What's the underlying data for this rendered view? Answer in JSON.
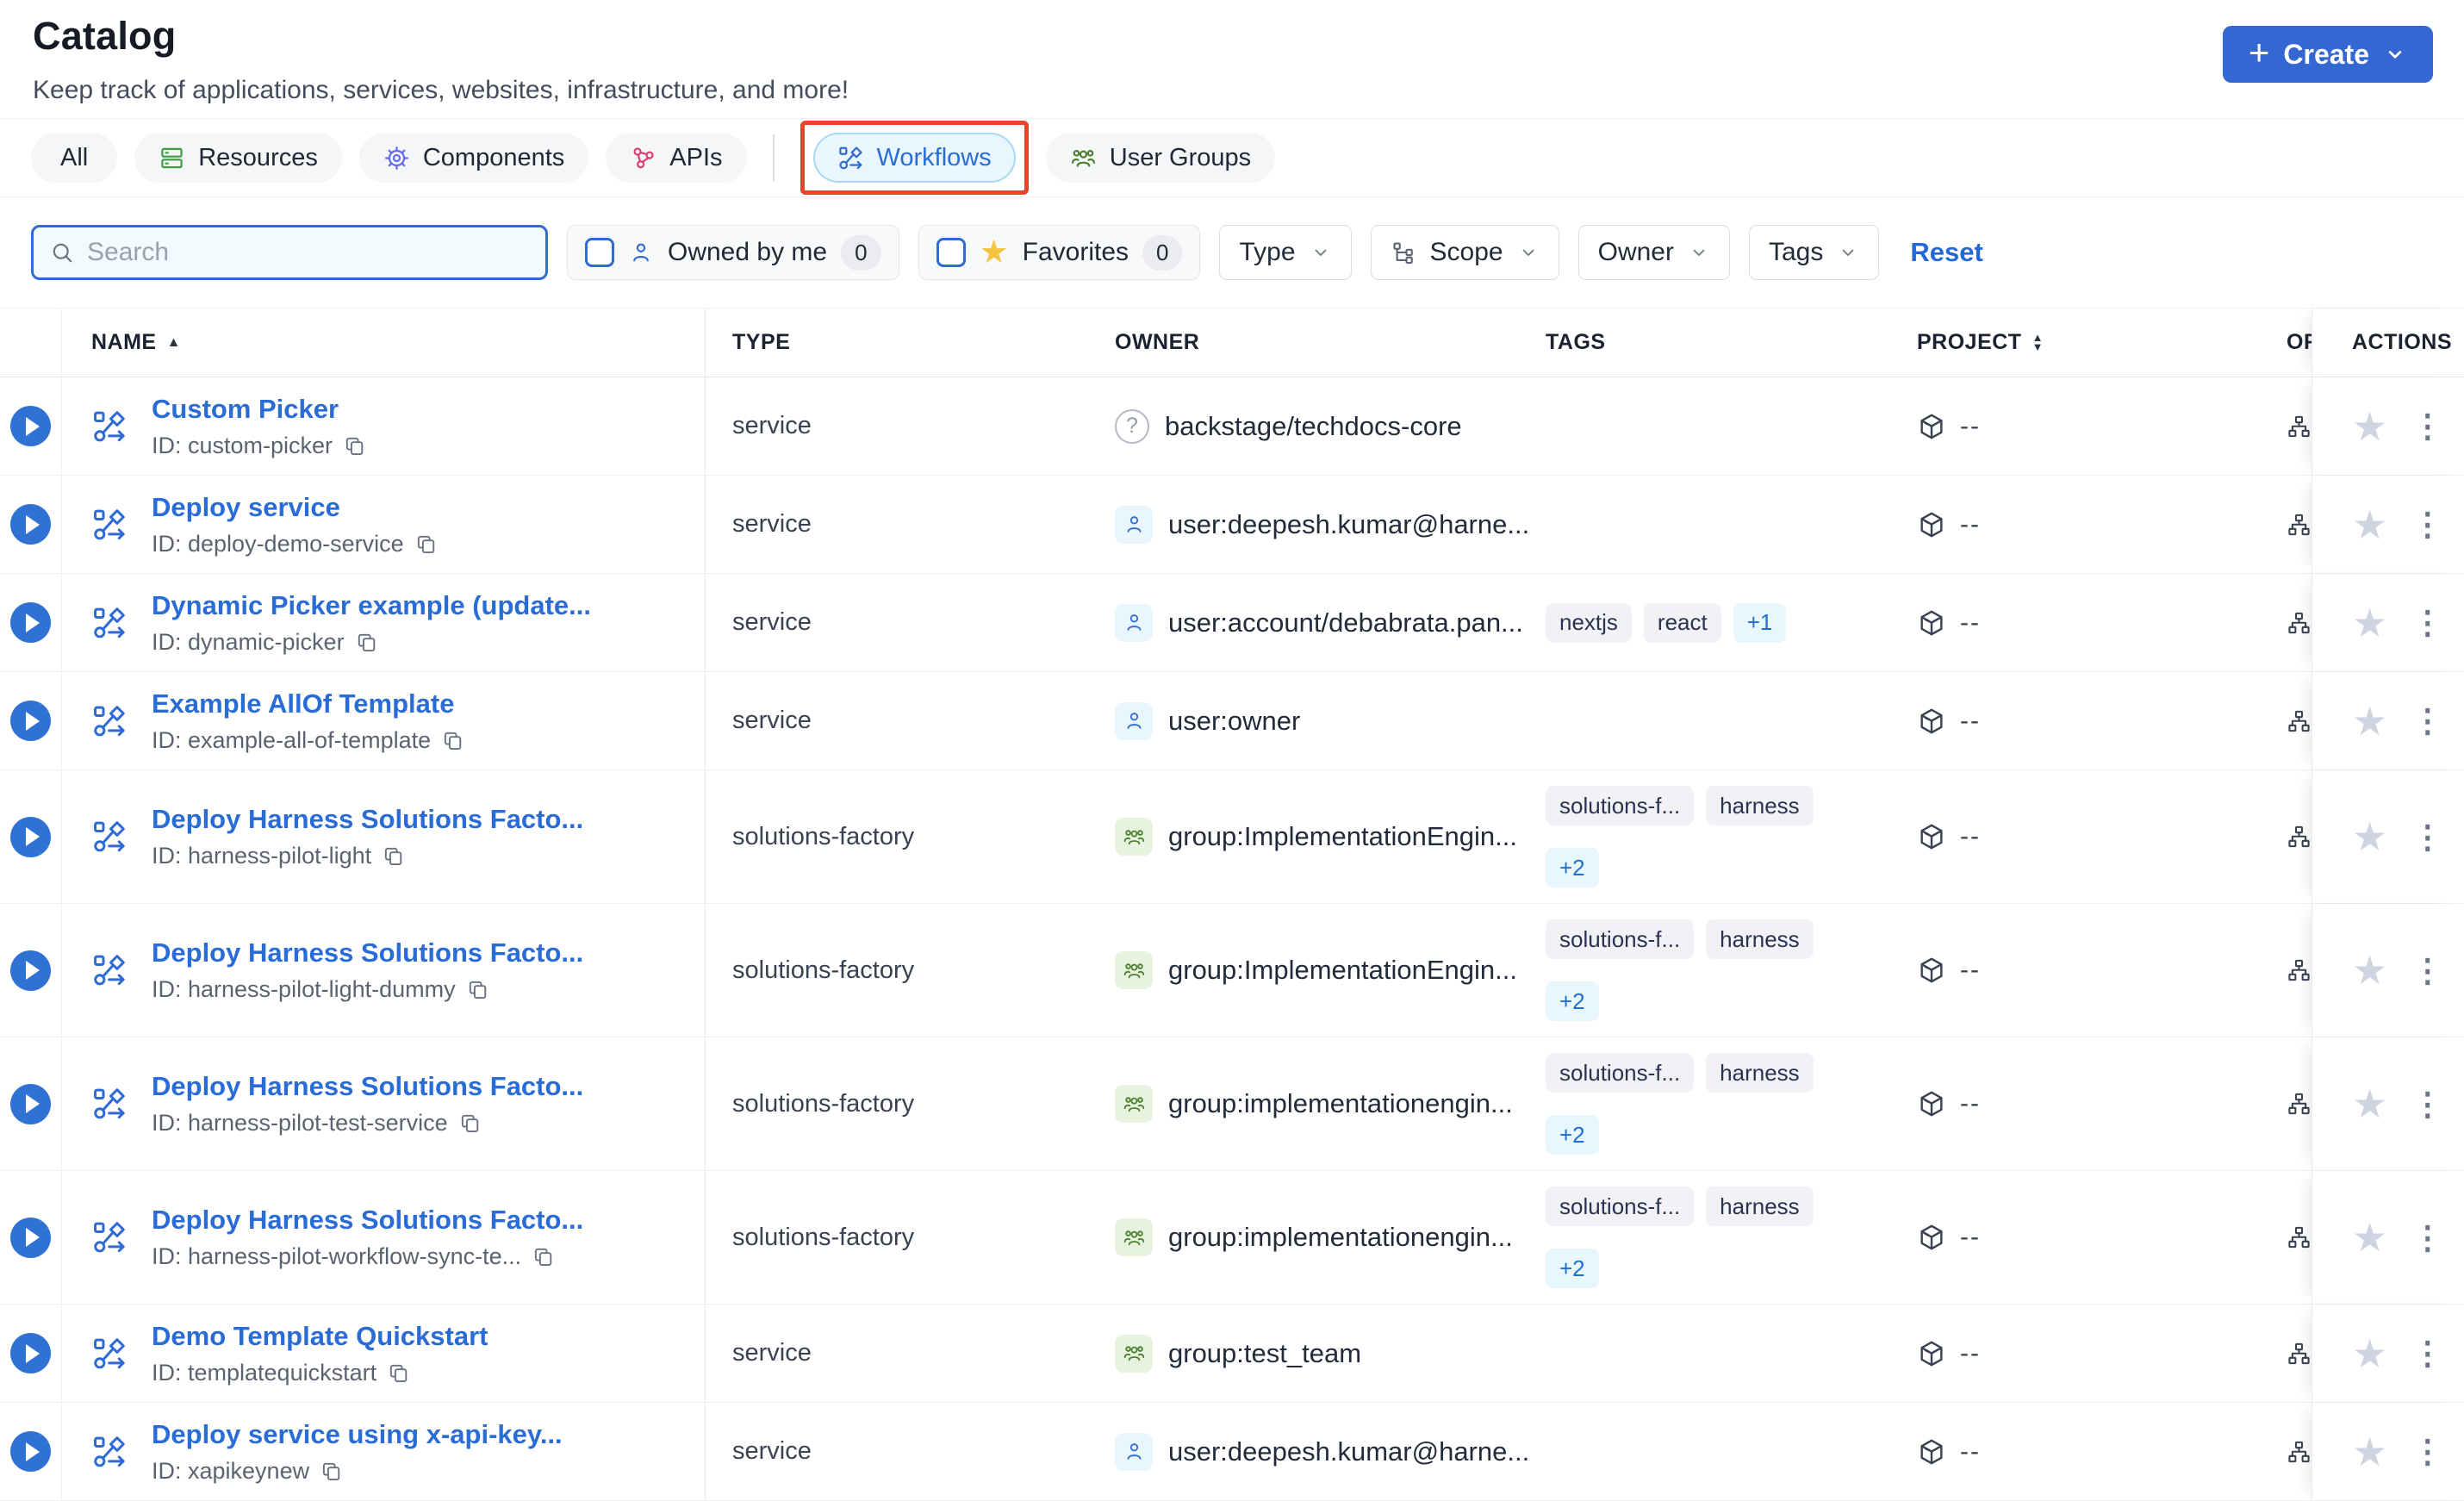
{
  "colors": {
    "accent_blue": "#2F6BD2",
    "annotation_red": "#E8432C",
    "selected_tab_bg": "#E9F6FD",
    "tag_bg": "#F1F1F6",
    "tag_more_bg": "#E8F6FD",
    "star_yellow": "#F5C33F",
    "star_gray": "#CFD5E0",
    "create_button_bg": "#3467D1"
  },
  "header": {
    "title": "Catalog",
    "subtitle": "Keep track of applications, services, websites, infrastructure, and more!",
    "create_button": {
      "label": "Create"
    }
  },
  "tabs": {
    "items": [
      {
        "label": "All",
        "icon": "none",
        "active": false
      },
      {
        "label": "Resources",
        "icon": "resources-icon",
        "active": false
      },
      {
        "label": "Components",
        "icon": "components-gear-icon",
        "active": false
      },
      {
        "label": "APIs",
        "icon": "apis-icon",
        "active": false
      },
      {
        "label": "Workflows",
        "icon": "workflow-icon",
        "active": true,
        "annotated": true
      },
      {
        "label": "User Groups",
        "icon": "user-groups-icon",
        "active": false
      }
    ],
    "annotation": {
      "shape": "red-highlight-box",
      "color": "#E8432C",
      "target": "Workflows"
    }
  },
  "filters": {
    "search": {
      "placeholder": "Search",
      "value": ""
    },
    "owned_by_me": {
      "label": "Owned by me",
      "count": "0",
      "checked": false
    },
    "favorites": {
      "label": "Favorites",
      "count": "0",
      "checked": false
    },
    "type_dropdown": {
      "label": "Type"
    },
    "scope_dropdown": {
      "label": "Scope"
    },
    "owner_dropdown": {
      "label": "Owner"
    },
    "tags_dropdown": {
      "label": "Tags"
    },
    "reset_label": "Reset"
  },
  "table": {
    "columns": {
      "name": "NAME",
      "type": "TYPE",
      "owner": "OWNER",
      "tags": "TAGS",
      "project": "PROJECT",
      "org_clipped": "OR",
      "actions": "ACTIONS"
    },
    "rows": [
      {
        "name": "Custom Picker",
        "id": "ID: custom-picker",
        "type": "service",
        "owner": "backstage/techdocs-core",
        "owner_icon": "question-icon",
        "tags": [],
        "project": "--"
      },
      {
        "name": "Deploy service",
        "id": "ID: deploy-demo-service",
        "type": "service",
        "owner": "user:deepesh.kumar@harne...",
        "owner_icon": "user-icon",
        "tags": [],
        "project": "--"
      },
      {
        "name": "Dynamic Picker example (update...",
        "id": "ID: dynamic-picker",
        "type": "service",
        "owner": "user:account/debabrata.pan...",
        "owner_icon": "user-icon",
        "tags": [
          {
            "label": "nextjs",
            "kind": "default"
          },
          {
            "label": "react",
            "kind": "default"
          },
          {
            "label": "+1",
            "kind": "more"
          }
        ],
        "project": "--"
      },
      {
        "name": "Example AllOf Template",
        "id": "ID: example-all-of-template",
        "type": "service",
        "owner": "user:owner",
        "owner_icon": "user-icon",
        "tags": [],
        "project": "--"
      },
      {
        "name": "Deploy Harness Solutions Facto...",
        "id": "ID: harness-pilot-light",
        "type": "solutions-factory",
        "owner": "group:ImplementationEngin...",
        "owner_icon": "group-icon",
        "tags": [
          {
            "label": "solutions-f...",
            "kind": "default"
          },
          {
            "label": "harness",
            "kind": "default"
          },
          {
            "label": "+2",
            "kind": "more",
            "new_line": true
          }
        ],
        "project": "--"
      },
      {
        "name": "Deploy Harness Solutions Facto...",
        "id": "ID: harness-pilot-light-dummy",
        "type": "solutions-factory",
        "owner": "group:ImplementationEngin...",
        "owner_icon": "group-icon",
        "tags": [
          {
            "label": "solutions-f...",
            "kind": "default"
          },
          {
            "label": "harness",
            "kind": "default"
          },
          {
            "label": "+2",
            "kind": "more",
            "new_line": true
          }
        ],
        "project": "--"
      },
      {
        "name": "Deploy Harness Solutions Facto...",
        "id": "ID: harness-pilot-test-service",
        "type": "solutions-factory",
        "owner": "group:implementationengin...",
        "owner_icon": "group-icon",
        "tags": [
          {
            "label": "solutions-f...",
            "kind": "default"
          },
          {
            "label": "harness",
            "kind": "default"
          },
          {
            "label": "+2",
            "kind": "more",
            "new_line": true
          }
        ],
        "project": "--"
      },
      {
        "name": "Deploy Harness Solutions Facto...",
        "id": "ID: harness-pilot-workflow-sync-te...",
        "type": "solutions-factory",
        "owner": "group:implementationengin...",
        "owner_icon": "group-icon",
        "tags": [
          {
            "label": "solutions-f...",
            "kind": "default"
          },
          {
            "label": "harness",
            "kind": "default"
          },
          {
            "label": "+2",
            "kind": "more",
            "new_line": true
          }
        ],
        "project": "--"
      },
      {
        "name": "Demo Template Quickstart",
        "id": "ID: templatequickstart",
        "type": "service",
        "owner": "group:test_team",
        "owner_icon": "group-icon",
        "tags": [],
        "project": "--"
      },
      {
        "name": "Deploy service using x-api-key...",
        "id": "ID: xapikeynew",
        "type": "service",
        "owner": "user:deepesh.kumar@harne...",
        "owner_icon": "user-icon",
        "tags": [],
        "project": "--"
      }
    ]
  }
}
